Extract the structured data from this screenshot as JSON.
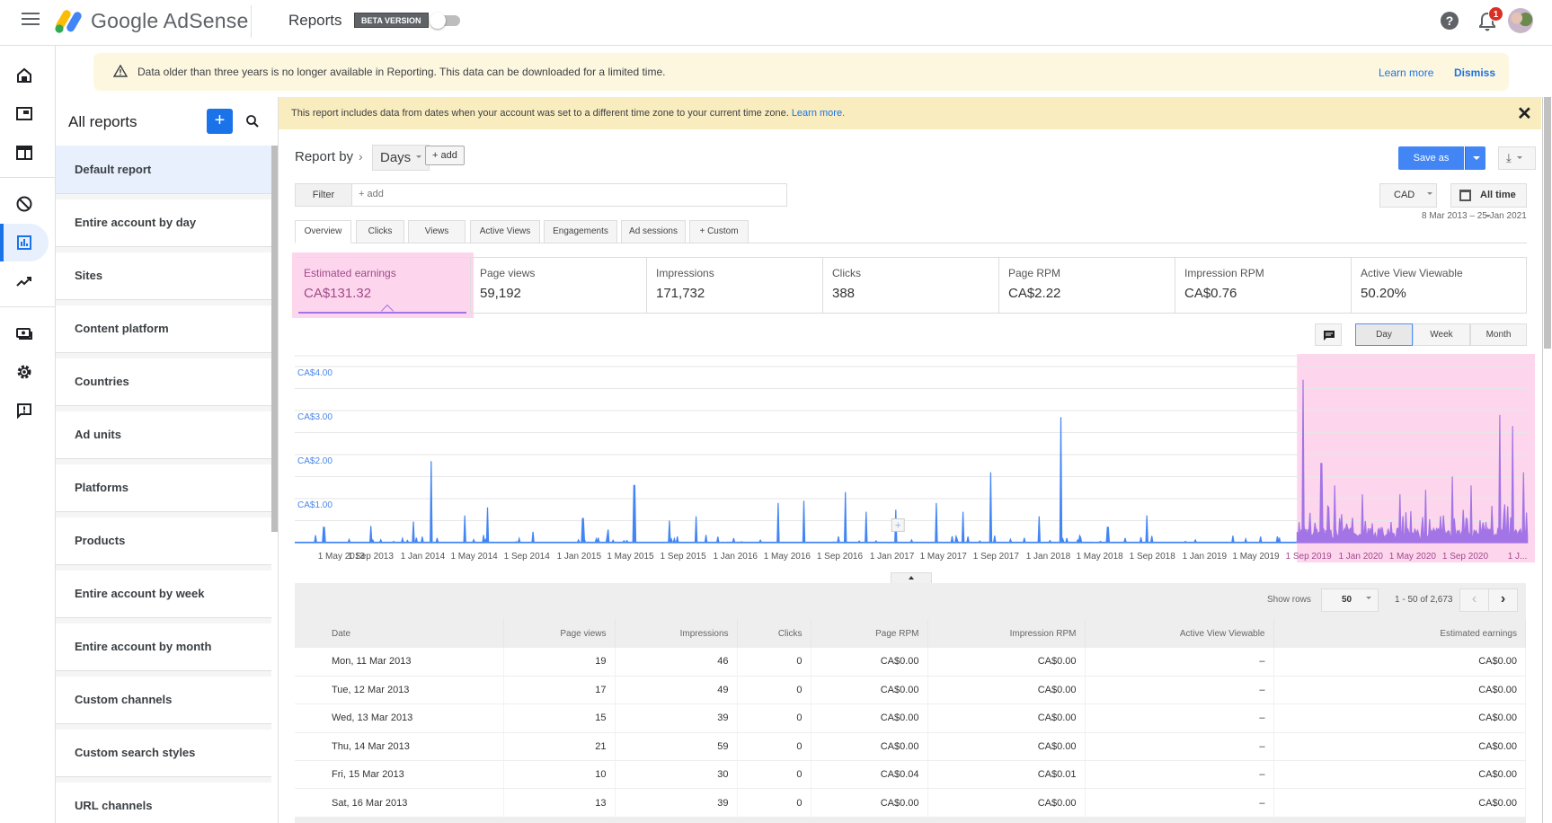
{
  "header": {
    "app_name": "Google AdSense",
    "page_title": "Reports",
    "beta_badge": "BETA VERSION",
    "help_glyph": "?",
    "notification_count": "1"
  },
  "rail": {
    "items": [
      {
        "icon": "home-icon"
      },
      {
        "icon": "ads-icon"
      },
      {
        "icon": "sites-icon"
      },
      {
        "icon": "blocking-controls-icon"
      },
      {
        "icon": "reports-icon",
        "active": true
      },
      {
        "icon": "optimization-icon"
      },
      {
        "icon": "payments-icon"
      },
      {
        "icon": "settings-icon"
      },
      {
        "icon": "feedback-icon"
      }
    ]
  },
  "alert": {
    "message": "Data older than three years is no longer available in Reporting. This data can be downloaded for a limited time.",
    "learn_more": "Learn more",
    "dismiss": "Dismiss"
  },
  "reports": {
    "title": "All reports",
    "add_glyph": "+",
    "items": [
      "Default report",
      "Entire account by day",
      "Sites",
      "Content platform",
      "Countries",
      "Ad units",
      "Platforms",
      "Products",
      "Entire account by week",
      "Entire account by month",
      "Custom channels",
      "Custom search styles",
      "URL channels"
    ]
  },
  "tz_banner": {
    "message": "This report includes data from dates when your account was set to a different time zone to your current time zone.",
    "link": "Learn more.",
    "close_glyph": "✕"
  },
  "toolbar": {
    "report_by": "Report by",
    "chevron": "›",
    "dimension": "Days",
    "add_dimension": "+ add",
    "filter_label": "Filter",
    "filter_placeholder": "+ add",
    "save_as": "Save as",
    "download_glyph": "⤓",
    "currency": "CAD",
    "date_preset": "All time",
    "date_range": "8 Mar 2013 – 25 Jan 2021"
  },
  "tabs": [
    "Overview",
    "Clicks",
    "Views",
    "Active Views",
    "Engagements",
    "Ad sessions",
    "+ Custom"
  ],
  "metrics": [
    {
      "label": "Estimated earnings",
      "value": "CA$131.32",
      "active": true
    },
    {
      "label": "Page views",
      "value": "59,192"
    },
    {
      "label": "Impressions",
      "value": "171,732"
    },
    {
      "label": "Clicks",
      "value": "388"
    },
    {
      "label": "Page RPM",
      "value": "CA$2.22"
    },
    {
      "label": "Impression RPM",
      "value": "CA$0.76"
    },
    {
      "label": "Active View Viewable",
      "value": "50.20%"
    }
  ],
  "granularity": [
    "Day",
    "Week",
    "Month"
  ],
  "colors": {
    "primary": "#4285f4",
    "highlight_series": "#a374e6",
    "highlight_bg": "#fdd6ee",
    "banner": "#f9ecbf",
    "alert": "#fef7e0"
  },
  "chart_data": {
    "type": "line",
    "title": "",
    "xlabel": "",
    "ylabel": "Estimated earnings",
    "ylim": [
      0,
      4
    ],
    "y_ticks": [
      "CA$1.00",
      "CA$2.00",
      "CA$3.00",
      "CA$4.00"
    ],
    "x_ticks": [
      "1 May 2013",
      "1 Sep 2013",
      "1 Jan 2014",
      "1 May 2014",
      "1 Sep 2014",
      "1 Jan 2015",
      "1 May 2015",
      "1 Sep 2015",
      "1 Jan 2016",
      "1 May 2016",
      "1 Sep 2016",
      "1 Jan 2017",
      "1 May 2017",
      "1 Sep 2017",
      "1 Jan 2018",
      "1 May 2018",
      "1 Sep 2018",
      "1 Jan 2019",
      "1 May 2019",
      "1 Sep 2019",
      "1 Jan 2020",
      "1 May 2020",
      "1 Sep 2020",
      "1 J..."
    ],
    "x_range": [
      "8 Mar 2013",
      "25 Jan 2021"
    ],
    "grid": true,
    "highlighted_range": [
      "Aug 2019",
      "Jan 2021"
    ],
    "series": [
      {
        "name": "Estimated earnings (daily)",
        "spikes": [
          {
            "date": "2013-05-15",
            "value": 0.35
          },
          {
            "date": "2013-09-01",
            "value": 0.38
          },
          {
            "date": "2013-12-10",
            "value": 0.48
          },
          {
            "date": "2014-01-20",
            "value": 1.85
          },
          {
            "date": "2014-04-10",
            "value": 0.62
          },
          {
            "date": "2014-06-01",
            "value": 0.8
          },
          {
            "date": "2014-09-15",
            "value": 0.25
          },
          {
            "date": "2015-01-10",
            "value": 0.55
          },
          {
            "date": "2015-03-10",
            "value": 0.3
          },
          {
            "date": "2015-05-10",
            "value": 1.3
          },
          {
            "date": "2015-08-01",
            "value": 0.5
          },
          {
            "date": "2015-10-01",
            "value": 0.6
          },
          {
            "date": "2016-04-10",
            "value": 0.9
          },
          {
            "date": "2016-06-10",
            "value": 0.95
          },
          {
            "date": "2016-09-15",
            "value": 1.15
          },
          {
            "date": "2016-11-01",
            "value": 0.7
          },
          {
            "date": "2017-01-10",
            "value": 0.75
          },
          {
            "date": "2017-04-15",
            "value": 0.9
          },
          {
            "date": "2017-06-15",
            "value": 0.7
          },
          {
            "date": "2017-08-20",
            "value": 1.6
          },
          {
            "date": "2017-12-10",
            "value": 0.6
          },
          {
            "date": "2018-01-30",
            "value": 2.85
          },
          {
            "date": "2018-05-20",
            "value": 0.35
          },
          {
            "date": "2018-08-20",
            "value": 0.62
          },
          {
            "date": "2019-08-20",
            "value": 3.7
          },
          {
            "date": "2019-10-01",
            "value": 1.8
          },
          {
            "date": "2019-11-01",
            "value": 1.3
          },
          {
            "date": "2020-01-05",
            "value": 1.1
          },
          {
            "date": "2020-04-01",
            "value": 1.1
          },
          {
            "date": "2020-06-01",
            "value": 1.2
          },
          {
            "date": "2020-08-01",
            "value": 1.5
          },
          {
            "date": "2020-09-15",
            "value": 1.3
          },
          {
            "date": "2020-11-20",
            "value": 2.9
          },
          {
            "date": "2020-12-20",
            "value": 2.65
          },
          {
            "date": "2021-01-15",
            "value": 1.6
          }
        ]
      }
    ]
  },
  "table": {
    "show_rows_label": "Show rows",
    "rows_per_page": "50",
    "page_info": "1 - 50 of 2,673",
    "prev_glyph": "‹",
    "next_glyph": "›",
    "columns": [
      "Date",
      "Page views",
      "Impressions",
      "Clicks",
      "Page RPM",
      "Impression RPM",
      "Active View Viewable",
      "Estimated earnings"
    ],
    "rows": [
      [
        "Mon, 11 Mar 2013",
        "19",
        "46",
        "0",
        "CA$0.00",
        "CA$0.00",
        "–",
        "CA$0.00"
      ],
      [
        "Tue, 12 Mar 2013",
        "17",
        "49",
        "0",
        "CA$0.00",
        "CA$0.00",
        "–",
        "CA$0.00"
      ],
      [
        "Wed, 13 Mar 2013",
        "15",
        "39",
        "0",
        "CA$0.00",
        "CA$0.00",
        "–",
        "CA$0.00"
      ],
      [
        "Thu, 14 Mar 2013",
        "21",
        "59",
        "0",
        "CA$0.00",
        "CA$0.00",
        "–",
        "CA$0.00"
      ],
      [
        "Fri, 15 Mar 2013",
        "10",
        "30",
        "0",
        "CA$0.04",
        "CA$0.01",
        "–",
        "CA$0.00"
      ],
      [
        "Sat, 16 Mar 2013",
        "13",
        "39",
        "0",
        "CA$0.00",
        "CA$0.00",
        "–",
        "CA$0.00"
      ]
    ]
  }
}
